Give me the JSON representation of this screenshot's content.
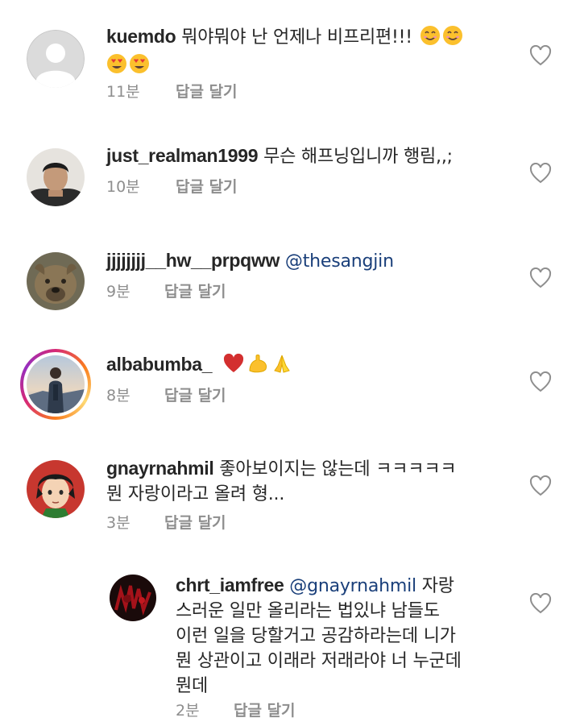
{
  "comments": [
    {
      "username": "kuemdo",
      "line1": "뭐야뭐야 난 언제나 비프리편!!!",
      "emojis_line1": [
        "smiling-face",
        "smiling-face"
      ],
      "emojis_line2": [
        "heart-eyes-face",
        "heart-eyes-face"
      ],
      "time": "11분",
      "reply_label": "답글 달기",
      "avatar_icon": "default-profile-icon"
    },
    {
      "username": "just_realman1999",
      "line1": "무슨 해프닝입니까 행림,,;",
      "time": "10분",
      "reply_label": "답글 달기",
      "avatar_icon": "profile-photo-young-man"
    },
    {
      "username": "jjjjjjjj__hw__prpqww",
      "mention": "@thesangjin",
      "time": "9분",
      "reply_label": "답글 달기",
      "avatar_icon": "profile-photo-dog"
    },
    {
      "username": "albabumba_",
      "emojis_line1": [
        "red-heart",
        "flexed-biceps",
        "folded-hands"
      ],
      "time": "8분",
      "reply_label": "답글 달기",
      "avatar_icon": "profile-photo-hiker",
      "has_story": true
    },
    {
      "username": "gnayrnahmil",
      "line1": "좋아보이지는 않는데 ㅋㅋㅋㅋㅋ",
      "line2": "뭔 자랑이라고 올려 형...",
      "time": "3분",
      "reply_label": "답글 달기",
      "avatar_icon": "profile-anime-character"
    },
    {
      "username": "chrt_iamfree",
      "mention": "@gnayrnahmil",
      "line1": "자랑",
      "line2": "스러운 일만 올리라는 법있냐 남들도",
      "line3": "이런 일을 당할거고 공감하라는데 니가",
      "line4": "뭔 상관이고 이래라 저래라야 너 누군데",
      "line5": "뭔데",
      "time": "2분",
      "reply_label": "답글 달기",
      "avatar_icon": "profile-dark-red-art",
      "is_reply": true
    }
  ],
  "colors": {
    "username": "#262626",
    "text": "#262626",
    "meta": "#8e8e8e",
    "mention": "#1a3f7a",
    "heart_outline": "#8e8e8e"
  }
}
